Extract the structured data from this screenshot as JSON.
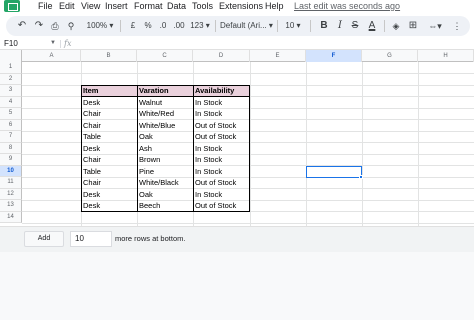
{
  "menu": {
    "items": [
      "File",
      "Edit",
      "View",
      "Insert",
      "Format",
      "Data",
      "Tools",
      "Extensions",
      "Help"
    ],
    "last_edit": "Last edit was seconds ago"
  },
  "toolbar": {
    "zoom": "100%",
    "currency": "£",
    "percent": "%",
    "decimal_decrease": ".0",
    "decimal_increase": ".00",
    "more_formats": "123",
    "font": "Default (Ari...",
    "font_size": "10",
    "bold": "B",
    "italic": "I",
    "strikethrough": "S",
    "text_color": "A"
  },
  "formula_bar": {
    "name_box": "F10",
    "fx": "fx",
    "value": ""
  },
  "columns": [
    "A",
    "B",
    "C",
    "D",
    "E",
    "F",
    "G",
    "H"
  ],
  "rows": [
    "1",
    "2",
    "3",
    "4",
    "5",
    "6",
    "7",
    "8",
    "9",
    "10",
    "11",
    "12",
    "13",
    "14"
  ],
  "active_cell": "F10",
  "table": {
    "headers": [
      "Item",
      "Varation",
      "Availability"
    ],
    "rows": [
      [
        "Desk",
        "Walnut",
        "In Stock"
      ],
      [
        "Chair",
        "White/Red",
        "In Stock"
      ],
      [
        "Chair",
        "White/Blue",
        "Out of Stock"
      ],
      [
        "Table",
        "Oak",
        "Out of Stock"
      ],
      [
        "Desk",
        "Ash",
        "In Stock"
      ],
      [
        "Chair",
        "Brown",
        "In Stock"
      ],
      [
        "Table",
        "Pine",
        "In Stock"
      ],
      [
        "Chair",
        "White/Black",
        "Out of Stock"
      ],
      [
        "Desk",
        "Oak",
        "In Stock"
      ],
      [
        "Desk",
        "Beech",
        "Out of Stock"
      ]
    ],
    "header_color": "#ead1dc"
  },
  "add_rows": {
    "button": "Add",
    "count": "10",
    "suffix": "more rows at bottom."
  },
  "colors": {
    "selection": "#1a73e8",
    "toolbar_bg": "#eef1f6",
    "logo": "#23a566"
  }
}
